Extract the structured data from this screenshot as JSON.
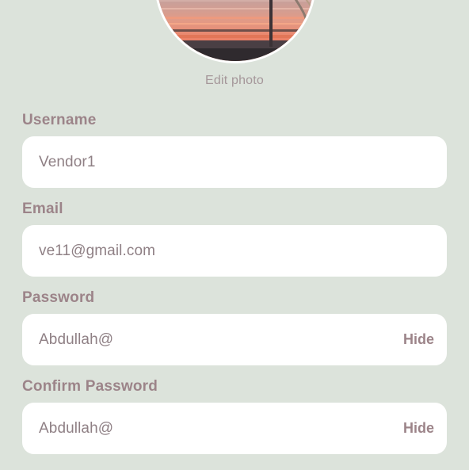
{
  "profile": {
    "edit_photo_label": "Edit photo"
  },
  "fields": {
    "username": {
      "label": "Username",
      "value": "Vendor1"
    },
    "email": {
      "label": "Email",
      "value": "ve11@gmail.com"
    },
    "password": {
      "label": "Password",
      "value": "Abdullah@",
      "toggle_label": "Hide"
    },
    "confirm_password": {
      "label": "Confirm Password",
      "value": "Abdullah@",
      "toggle_label": "Hide"
    }
  },
  "colors": {
    "background": "#dce3db",
    "label": "#9c8489",
    "value": "#8f8085",
    "field_bg": "#ffffff"
  }
}
